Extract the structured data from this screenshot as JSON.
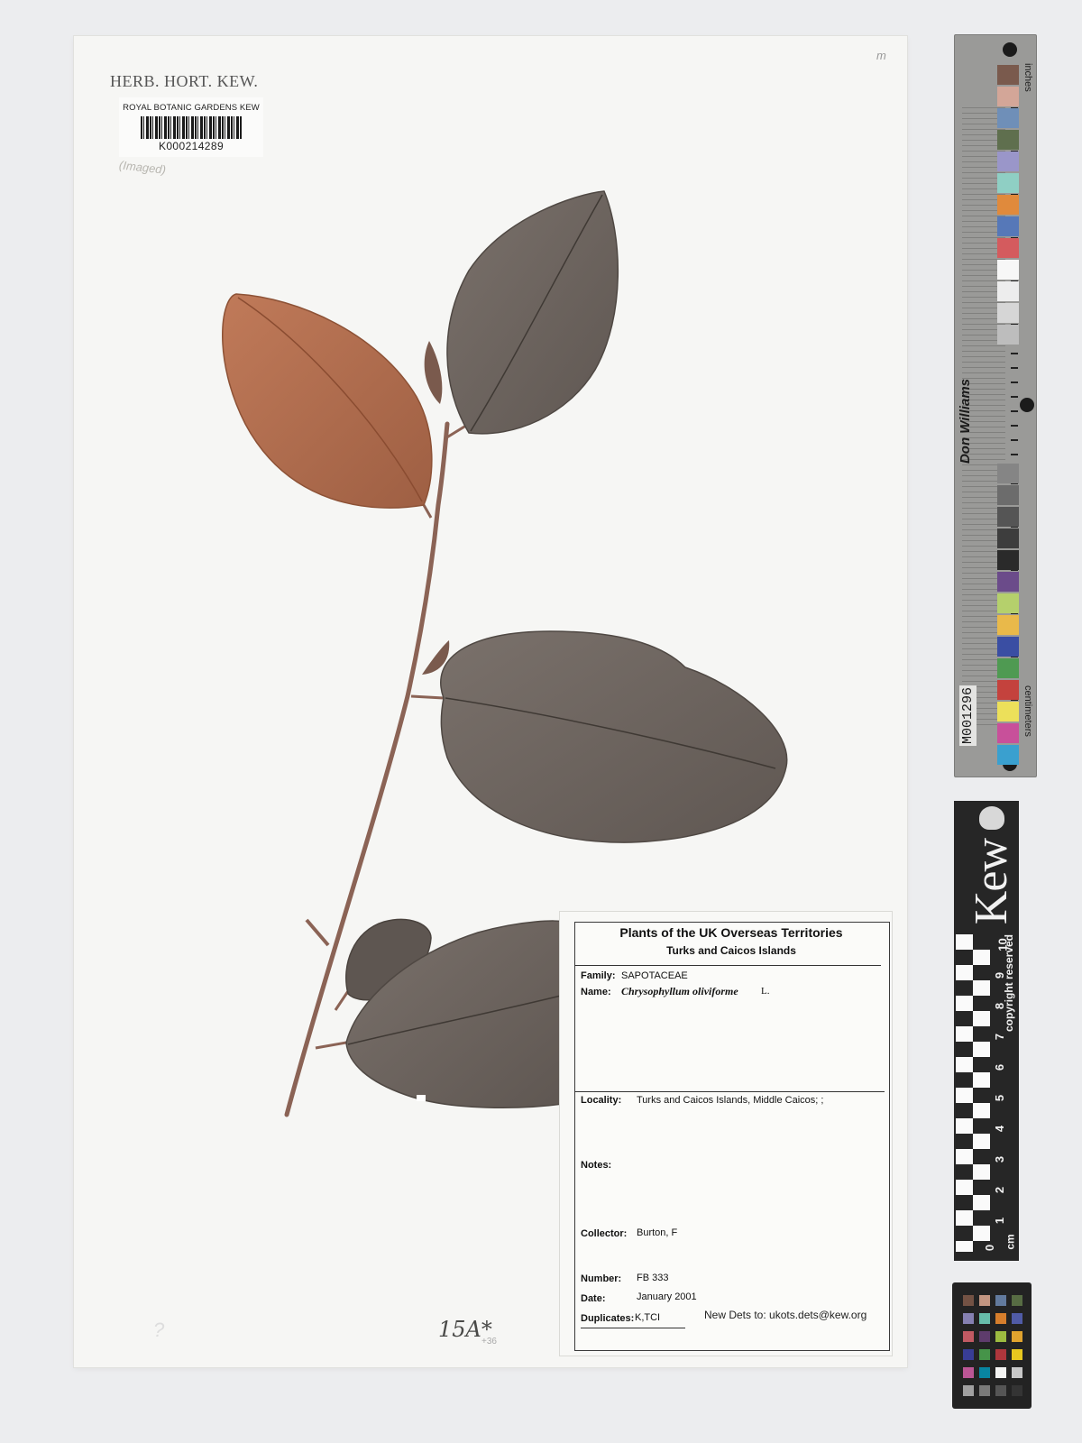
{
  "institution": {
    "herbarium_title": "HERB. HORT. KEW.",
    "barcode_institution": "ROYAL BOTANIC GARDENS KEW",
    "barcode_number": "K000214289"
  },
  "annotations": {
    "corner_mark": "m",
    "pencil_note": "(Imaged)",
    "handwritten_number": "15A*",
    "handwritten_small": "+36",
    "handwritten_question": "?"
  },
  "color_scale": {
    "code": "M001296",
    "maker": "Don Williams",
    "unit_top": "inches",
    "unit_bottom": "centimeters"
  },
  "kew_scale": {
    "wordmark": "Kew",
    "copyright": "copyright reserved",
    "unit": "cm",
    "ticks": [
      "0",
      "1",
      "2",
      "3",
      "4",
      "5",
      "6",
      "7",
      "8",
      "9",
      "10"
    ]
  },
  "label": {
    "title": "Plants of the UK Overseas Territories",
    "subtitle": "Turks and Caicos Islands",
    "family_label": "Family:",
    "family": "SAPOTACEAE",
    "name_label": "Name:",
    "name": "Chrysophyllum oliviforme",
    "author": "L.",
    "locality_label": "Locality:",
    "locality": "Turks and Caicos Islands, Middle Caicos; ;",
    "notes_label": "Notes:",
    "collector_label": "Collector:",
    "collector": "Burton, F",
    "number_label": "Number:",
    "number": "FB 333",
    "date_label": "Date:",
    "date": "January 2001",
    "duplicates_label": "Duplicates:",
    "duplicates": "K,TCI",
    "new_dets": "New Dets to: ukots.dets@kew.org"
  },
  "colors": {
    "leaf_dark": "#6b625c",
    "leaf_rust": "#b06d4f",
    "stem": "#8b6355"
  }
}
